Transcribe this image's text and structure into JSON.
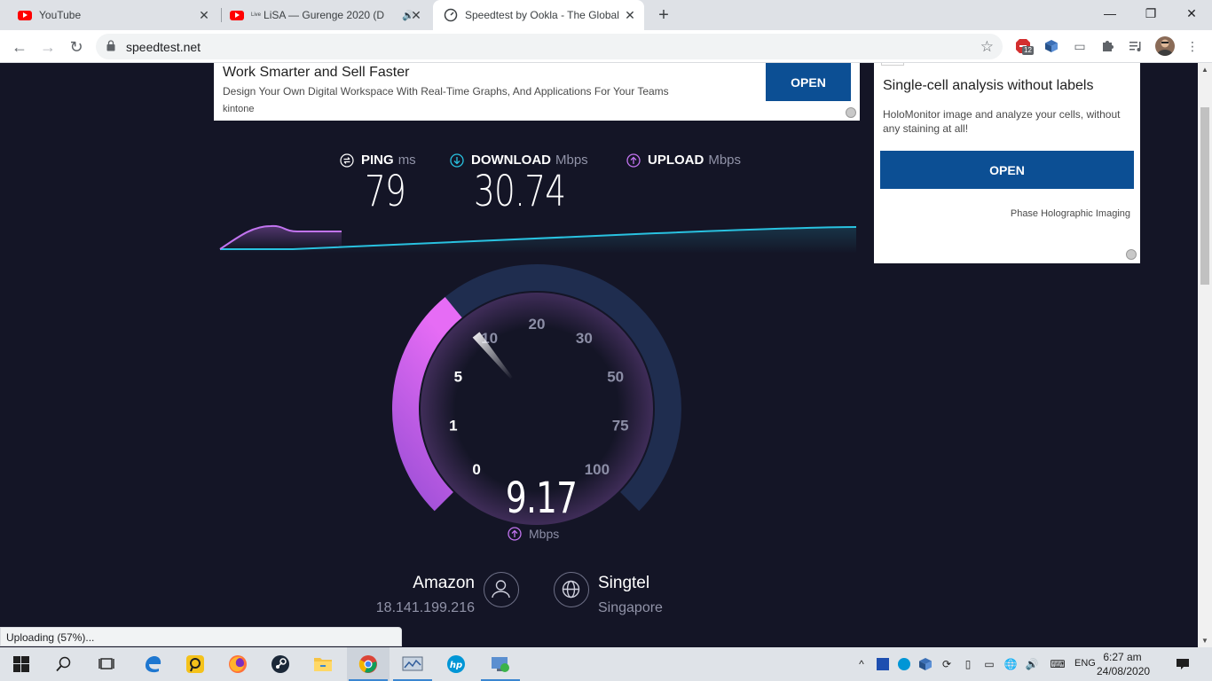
{
  "browser": {
    "tabs": [
      {
        "title": "YouTube",
        "live": "",
        "active": false
      },
      {
        "title": "LiSA — Gurenge 2020 (D",
        "live": "Live",
        "active": false
      },
      {
        "title": "Speedtest by Ookla - The Global",
        "live": "",
        "active": true
      }
    ],
    "url": "speedtest.net",
    "extension_badge": "12",
    "status_text": "Uploading (57%)..."
  },
  "ads": {
    "top": {
      "title": "Work Smarter and Sell Faster",
      "description": "Design Your Own Digital Workspace With Real-Time Graphs, And Applications For Your Teams",
      "brand": "kintone",
      "button": "OPEN"
    },
    "right": {
      "title": "Single-cell analysis without labels",
      "description": "HoloMonitor image and analyze your cells, without any staining at all!",
      "button": "OPEN",
      "brand": "Phase Holographic Imaging"
    }
  },
  "speedtest": {
    "ping": {
      "label": "PING",
      "unit": "ms",
      "value": "79"
    },
    "download": {
      "label": "DOWNLOAD",
      "unit": "Mbps",
      "value": "30.74"
    },
    "upload": {
      "label": "UPLOAD",
      "unit": "Mbps"
    },
    "gauge": {
      "current": "9.17",
      "current_value": 9.17,
      "unit": "Mbps",
      "ticks": [
        "0",
        "1",
        "5",
        "10",
        "20",
        "30",
        "50",
        "75",
        "100"
      ]
    },
    "host": {
      "name": "Amazon",
      "ip": "18.141.199.216"
    },
    "isp": {
      "name": "Singtel",
      "location": "Singapore"
    }
  },
  "colors": {
    "background": "#141526",
    "download": "#29c2e0",
    "upload": "#c274f0",
    "gauge_track": "#1f2d4f",
    "ad_button": "#0c4f94"
  },
  "taskbar": {
    "apps": [
      "start-icon",
      "search-icon",
      "task-view-icon",
      "edge-icon",
      "app-icon",
      "firefox-icon",
      "steam-icon",
      "file-explorer-icon",
      "chrome-icon",
      "app-icon",
      "hp-icon",
      "app-icon"
    ],
    "lang": "ENG",
    "time": "6:27 am",
    "date": "24/08/2020"
  }
}
